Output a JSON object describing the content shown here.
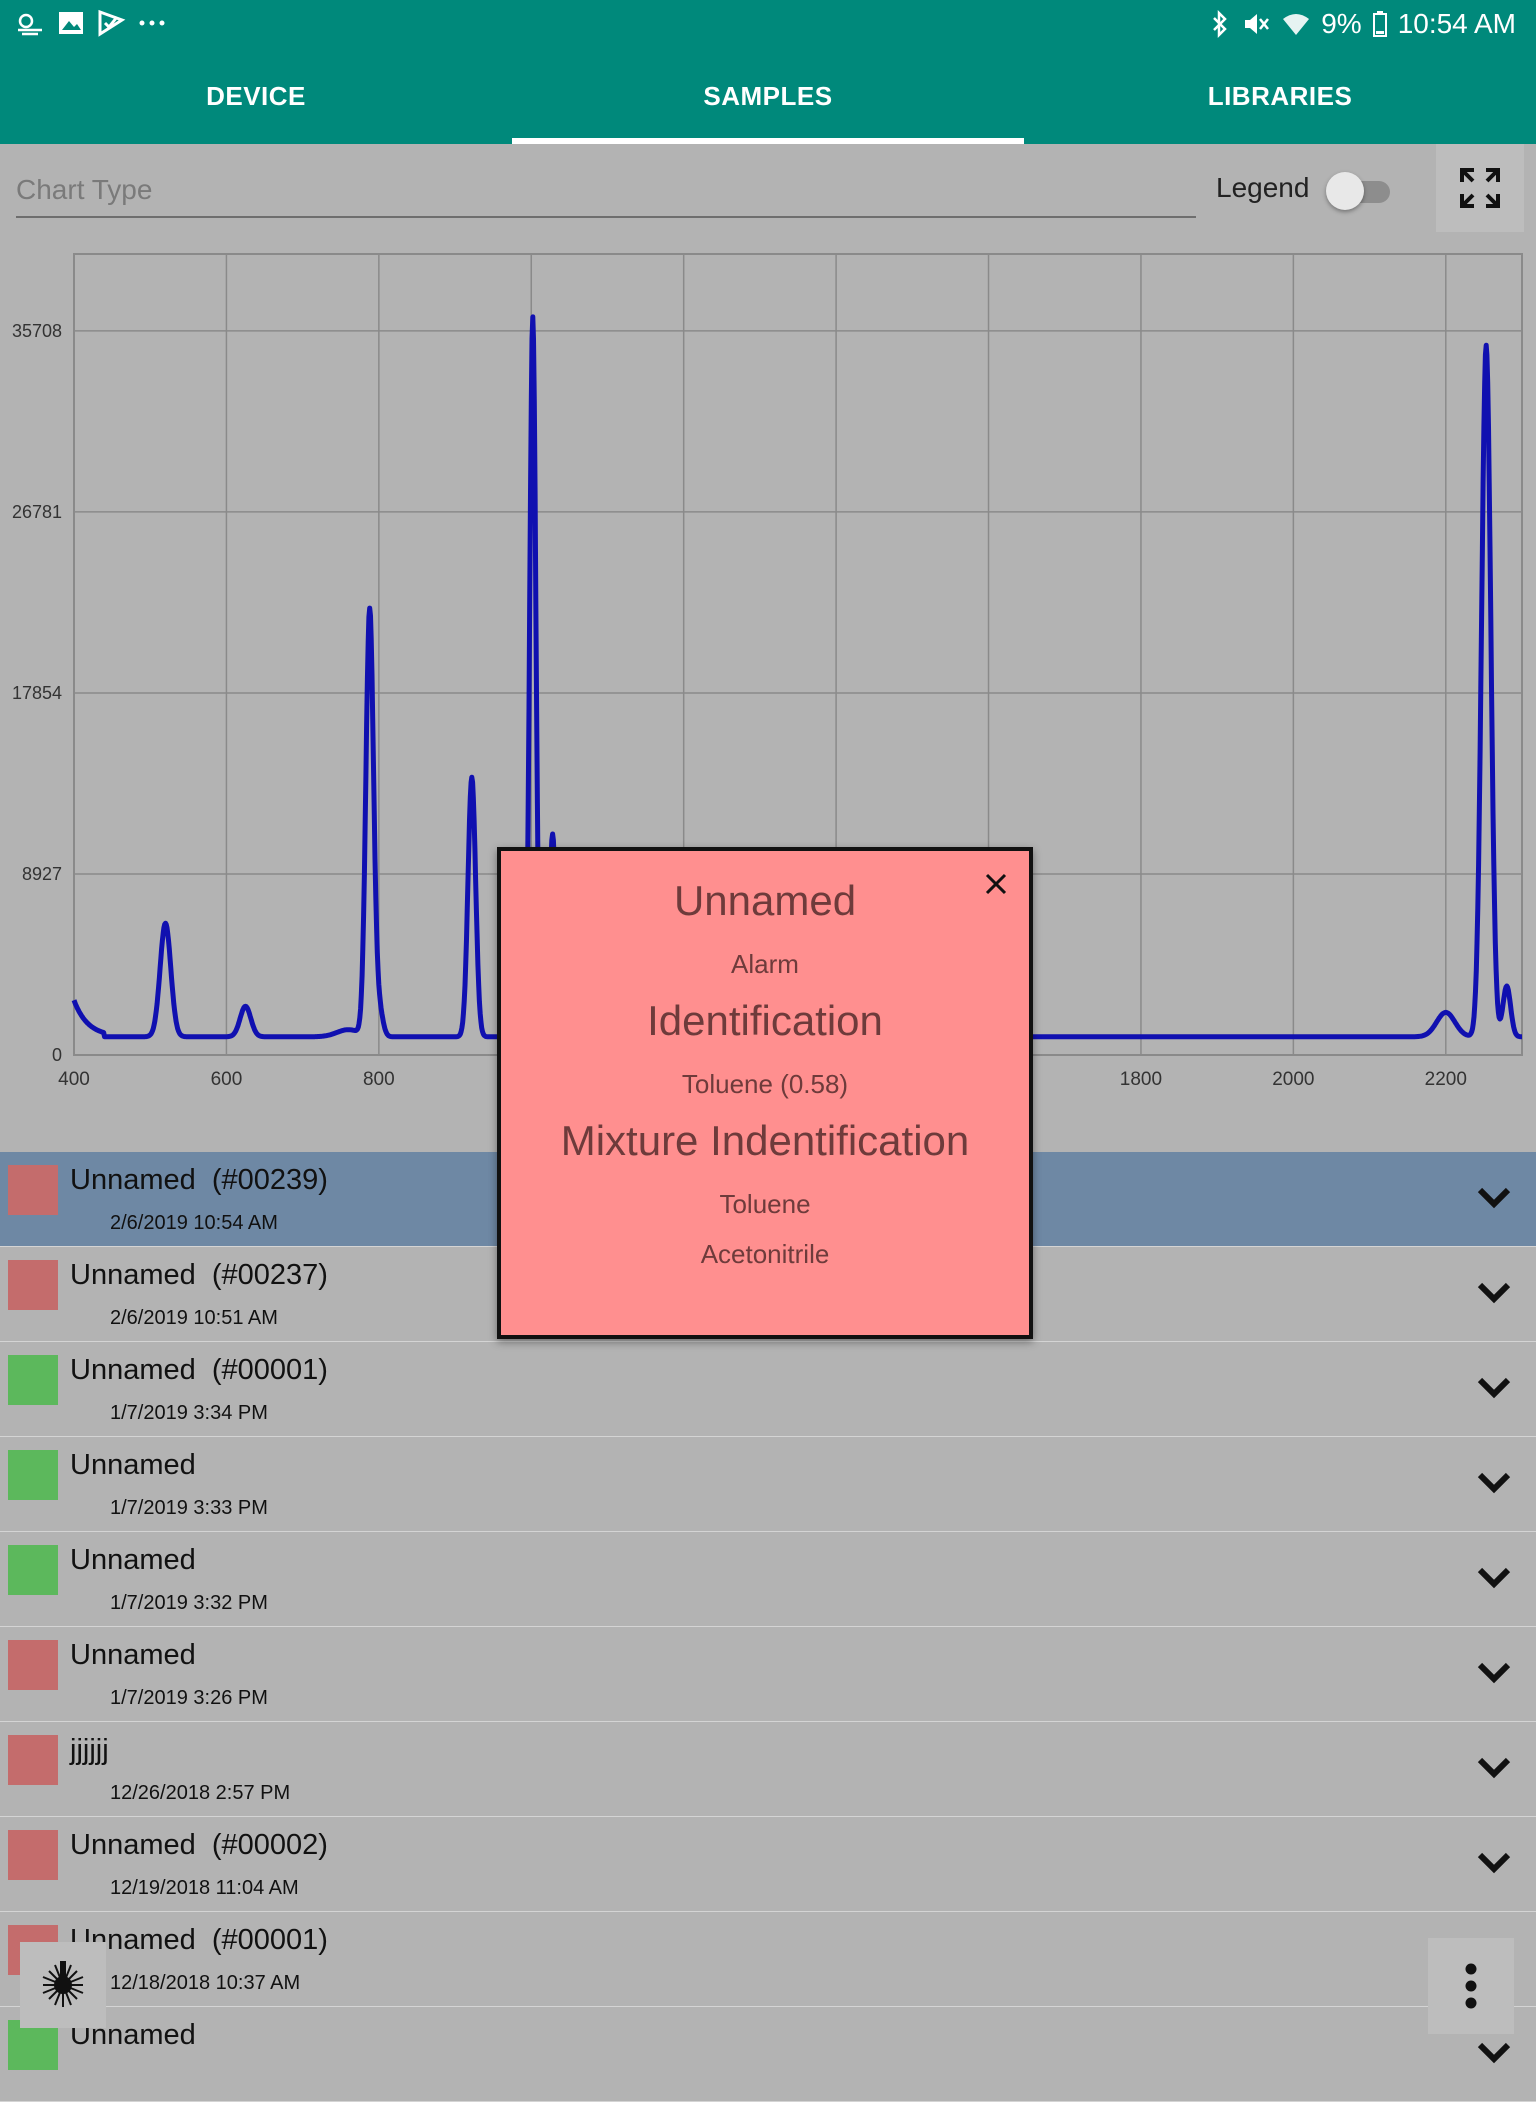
{
  "status_bar": {
    "battery": "9%",
    "time": "10:54 AM",
    "left_icons": [
      "weather-icon",
      "gallery-icon",
      "check-icon",
      "more-dots-icon"
    ],
    "right_icons": [
      "bluetooth-icon",
      "mute-icon",
      "wifi-icon",
      "battery-icon"
    ]
  },
  "tabs": [
    {
      "label": "DEVICE",
      "active": false
    },
    {
      "label": "SAMPLES",
      "active": true
    },
    {
      "label": "LIBRARIES",
      "active": false
    }
  ],
  "controls": {
    "chart_type_placeholder": "Chart Type",
    "legend_label": "Legend",
    "legend_on": false
  },
  "chart_data": {
    "type": "line",
    "xlim": [
      400,
      2300
    ],
    "ylim": [
      0,
      39500
    ],
    "x_ticks": [
      400,
      600,
      800,
      1000,
      1200,
      1400,
      1600,
      1800,
      2000,
      2200
    ],
    "x_tick_labels": [
      "400",
      "600",
      "800",
      "",
      "",
      "",
      "",
      "1800",
      "2000",
      "2200"
    ],
    "y_ticks": [
      0,
      8927,
      17854,
      26781,
      35708
    ],
    "y_tick_labels": [
      "0",
      "8927",
      "17854",
      "26781",
      "35708"
    ],
    "grid": true,
    "color": "#1010b0",
    "series": [
      {
        "baseline": 900,
        "peaks": [
          {
            "x": 520,
            "height": 5600,
            "width": 7
          },
          {
            "x": 625,
            "height": 1500,
            "width": 7
          },
          {
            "x": 760,
            "height": 350,
            "width": 15
          },
          {
            "x": 788,
            "height": 21000,
            "width": 5
          },
          {
            "x": 800,
            "height": 1400,
            "width": 5
          },
          {
            "x": 922,
            "height": 12800,
            "width": 5
          },
          {
            "x": 1002,
            "height": 35500,
            "width": 4
          },
          {
            "x": 1028,
            "height": 10000,
            "width": 4
          },
          {
            "x": 2200,
            "height": 1200,
            "width": 12
          },
          {
            "x": 2253,
            "height": 34100,
            "width": 6
          },
          {
            "x": 2280,
            "height": 2500,
            "width": 5
          }
        ]
      }
    ]
  },
  "popup": {
    "title": "Unnamed",
    "status": "Alarm",
    "identification_heading": "Identification",
    "identification_value": "Toluene (0.58)",
    "mixture_heading": "Mixture Indentification",
    "mixture_items": [
      "Toluene",
      "Acetonitrile"
    ]
  },
  "samples": [
    {
      "name": "Unnamed  (#00239)",
      "date": "2/6/2019 10:54 AM",
      "color": "#c46c6c",
      "selected": true
    },
    {
      "name": "Unnamed  (#00237)",
      "date": "2/6/2019 10:51 AM",
      "color": "#c46c6c",
      "selected": false
    },
    {
      "name": "Unnamed  (#00001)",
      "date": "1/7/2019 3:34 PM",
      "color": "#5cb85c",
      "selected": false
    },
    {
      "name": "Unnamed",
      "date": "1/7/2019 3:33 PM",
      "color": "#5cb85c",
      "selected": false
    },
    {
      "name": "Unnamed",
      "date": "1/7/2019 3:32 PM",
      "color": "#5cb85c",
      "selected": false
    },
    {
      "name": "Unnamed",
      "date": "1/7/2019 3:26 PM",
      "color": "#c46c6c",
      "selected": false
    },
    {
      "name": "jjjjjj",
      "date": "12/26/2018 2:57 PM",
      "color": "#c46c6c",
      "selected": false
    },
    {
      "name": "Unnamed  (#00002)",
      "date": "12/19/2018 11:04 AM",
      "color": "#c46c6c",
      "selected": false
    },
    {
      "name": "Unnamed  (#00001)",
      "date": "12/18/2018 10:37 AM",
      "color": "#c46c6c",
      "selected": false
    },
    {
      "name": "Unnamed",
      "date": "",
      "color": "#5cb85c",
      "selected": false
    }
  ]
}
